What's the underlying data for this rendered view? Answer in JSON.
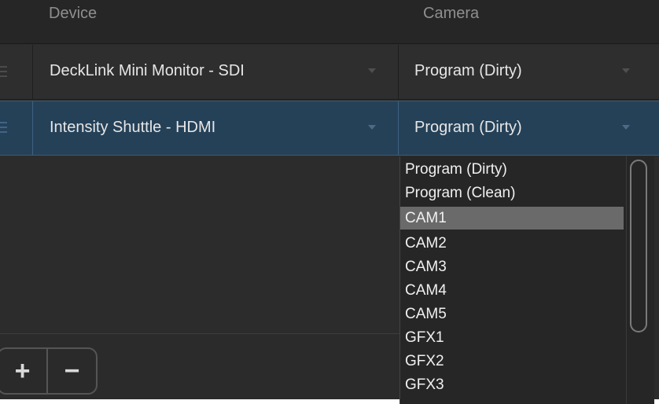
{
  "header": {
    "device_label": "Device",
    "camera_label": "Camera"
  },
  "rows": [
    {
      "device": "DeckLink Mini Monitor - SDI",
      "camera": "Program (Dirty)",
      "selected": false
    },
    {
      "device": "Intensity Shuttle - HDMI",
      "camera": "Program (Dirty)",
      "selected": true
    }
  ],
  "footer": {
    "add_label": "+",
    "remove_label": "−"
  },
  "camera_dropdown": {
    "open": true,
    "highlighted": "CAM1",
    "options": [
      "Program (Dirty)",
      "Program (Clean)",
      "CAM1",
      "CAM2",
      "CAM3",
      "CAM4",
      "CAM5",
      "GFX1",
      "GFX2",
      "GFX3"
    ]
  },
  "colors": {
    "panel_bg": "#2b2b2b",
    "selected_row_bg": "#254158",
    "highlight_option_bg": "#6a6a6a",
    "text": "#e6e6e6"
  },
  "icons": {
    "drag_handle": "drag-handle-icon",
    "dropdown_caret": "chevron-down-icon"
  }
}
